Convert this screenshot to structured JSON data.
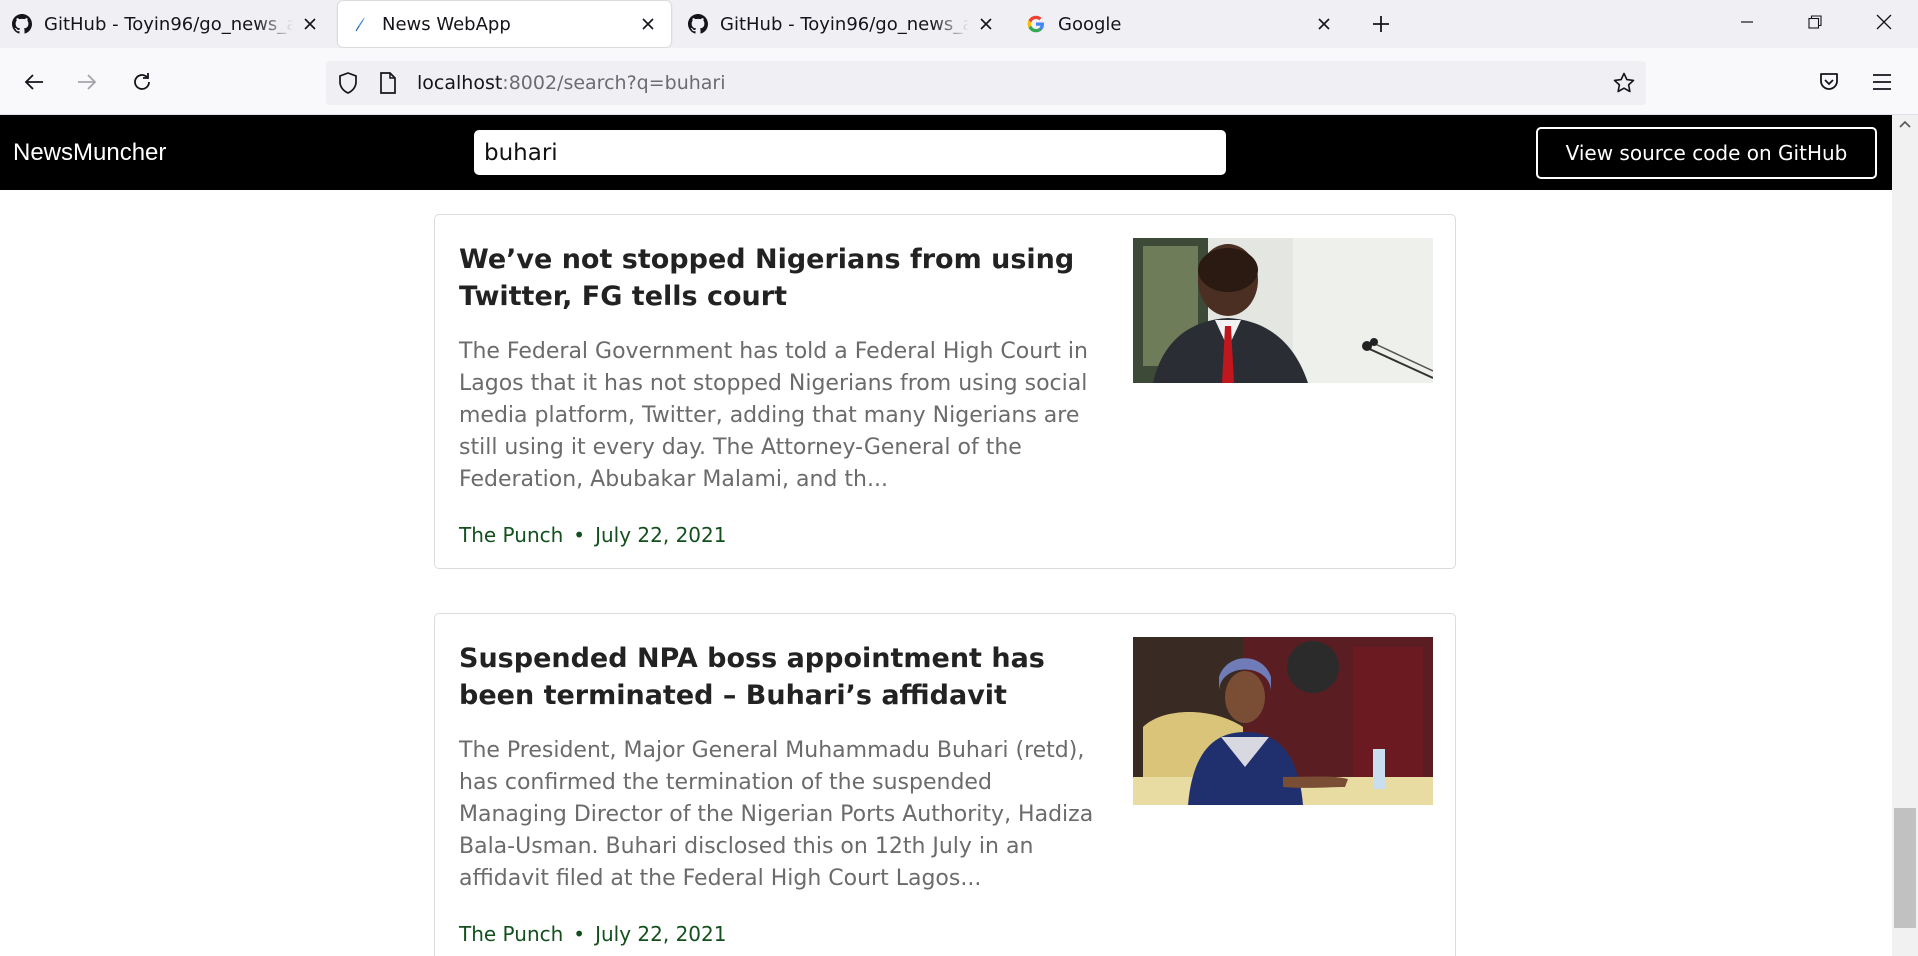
{
  "browser": {
    "tabs": [
      {
        "title": "GitHub - Toyin96/go_news_app: ",
        "icon": "github-icon",
        "active": false
      },
      {
        "title": "News WebApp",
        "icon": "feather-icon",
        "active": true
      },
      {
        "title": "GitHub - Toyin96/go_news_app: ",
        "icon": "github-icon",
        "active": false
      },
      {
        "title": "Google",
        "icon": "google-icon",
        "active": false
      }
    ],
    "url": {
      "host": "localhost",
      "rest": ":8002/search?q=buhari"
    }
  },
  "app": {
    "brand": "NewsMuncher",
    "search_value": "buhari",
    "github_button": "View source code on GitHub"
  },
  "articles": [
    {
      "title": "We’ve not stopped Nigerians from using Twitter, FG tells court",
      "description": "The Federal Government has told a Federal High Court in Lagos that it has not stopped Nigerians from using social media platform, Twitter, adding that many Nigerians are still using it every day. The Attorney-General of the Federation, Abubakar Malami, and th...",
      "source": "The Punch",
      "date": "July 22, 2021"
    },
    {
      "title": "Suspended NPA boss appointment has been terminated – Buhari’s affidavit",
      "description": "The President, Major General Muhammadu Buhari (retd), has confirmed the termination of the suspended Managing Director of the Nigerian Ports Authority, Hadiza Bala-Usman. Buhari disclosed this on 12th July in an affidavit filed at the Federal High Court Lagos...",
      "source": "The Punch",
      "date": "July 22, 2021"
    }
  ],
  "colors": {
    "header_bg": "#000000",
    "meta_green": "#14501e",
    "desc_grey": "#6b6b6b"
  }
}
